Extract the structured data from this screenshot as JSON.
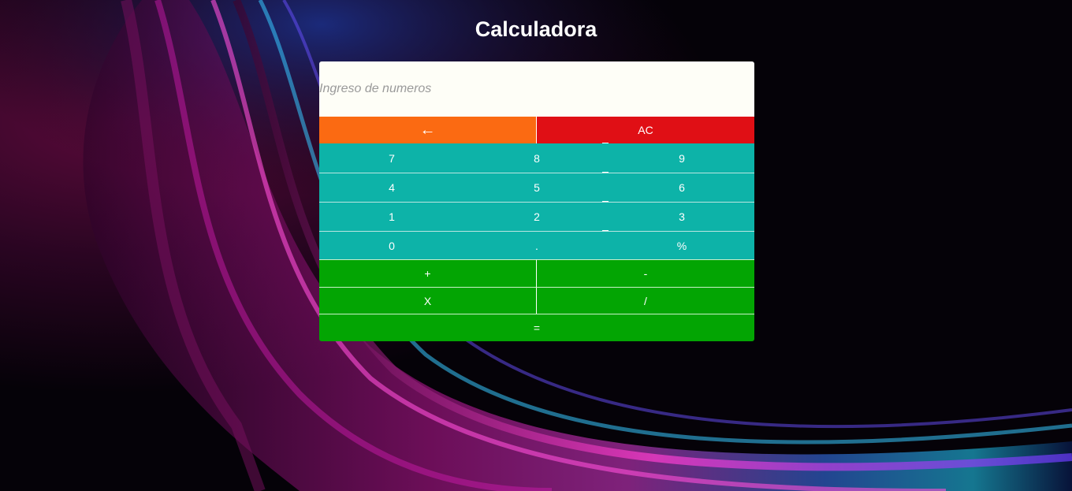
{
  "page": {
    "title": "Calculadora"
  },
  "display": {
    "value": "",
    "placeholder": "Ingreso de numeros"
  },
  "top_buttons": [
    {
      "label": "←",
      "color": "#fb6a12"
    },
    {
      "label": "AC",
      "color": "#e00f15"
    }
  ],
  "number_rows": [
    [
      "7",
      "8",
      "9"
    ],
    [
      "4",
      "5",
      "6"
    ],
    [
      "1",
      "2",
      "3"
    ],
    [
      "0",
      ".",
      "%"
    ]
  ],
  "operator_rows": [
    [
      "+",
      "-"
    ],
    [
      "X",
      "/"
    ],
    [
      "="
    ]
  ],
  "colors": {
    "number_key": "#0db3a8",
    "operator_key": "#03a503",
    "display_bg": "#fefef7"
  },
  "icons": {
    "backspace": "left-arrow-icon"
  }
}
